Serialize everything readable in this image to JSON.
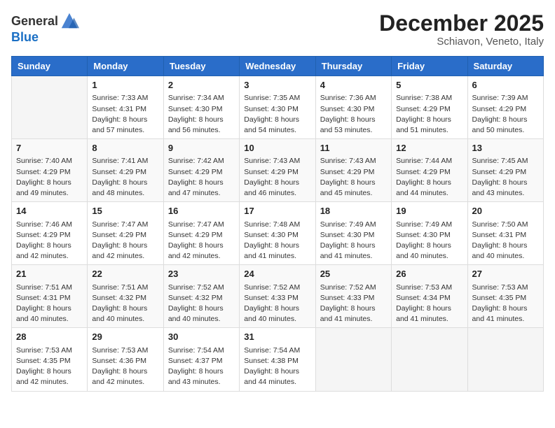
{
  "logo": {
    "general": "General",
    "blue": "Blue"
  },
  "header": {
    "month_year": "December 2025",
    "location": "Schiavon, Veneto, Italy"
  },
  "weekdays": [
    "Sunday",
    "Monday",
    "Tuesday",
    "Wednesday",
    "Thursday",
    "Friday",
    "Saturday"
  ],
  "weeks": [
    [
      {
        "day": "",
        "info": ""
      },
      {
        "day": "1",
        "info": "Sunrise: 7:33 AM\nSunset: 4:31 PM\nDaylight: 8 hours\nand 57 minutes."
      },
      {
        "day": "2",
        "info": "Sunrise: 7:34 AM\nSunset: 4:30 PM\nDaylight: 8 hours\nand 56 minutes."
      },
      {
        "day": "3",
        "info": "Sunrise: 7:35 AM\nSunset: 4:30 PM\nDaylight: 8 hours\nand 54 minutes."
      },
      {
        "day": "4",
        "info": "Sunrise: 7:36 AM\nSunset: 4:30 PM\nDaylight: 8 hours\nand 53 minutes."
      },
      {
        "day": "5",
        "info": "Sunrise: 7:38 AM\nSunset: 4:29 PM\nDaylight: 8 hours\nand 51 minutes."
      },
      {
        "day": "6",
        "info": "Sunrise: 7:39 AM\nSunset: 4:29 PM\nDaylight: 8 hours\nand 50 minutes."
      }
    ],
    [
      {
        "day": "7",
        "info": "Sunrise: 7:40 AM\nSunset: 4:29 PM\nDaylight: 8 hours\nand 49 minutes."
      },
      {
        "day": "8",
        "info": "Sunrise: 7:41 AM\nSunset: 4:29 PM\nDaylight: 8 hours\nand 48 minutes."
      },
      {
        "day": "9",
        "info": "Sunrise: 7:42 AM\nSunset: 4:29 PM\nDaylight: 8 hours\nand 47 minutes."
      },
      {
        "day": "10",
        "info": "Sunrise: 7:43 AM\nSunset: 4:29 PM\nDaylight: 8 hours\nand 46 minutes."
      },
      {
        "day": "11",
        "info": "Sunrise: 7:43 AM\nSunset: 4:29 PM\nDaylight: 8 hours\nand 45 minutes."
      },
      {
        "day": "12",
        "info": "Sunrise: 7:44 AM\nSunset: 4:29 PM\nDaylight: 8 hours\nand 44 minutes."
      },
      {
        "day": "13",
        "info": "Sunrise: 7:45 AM\nSunset: 4:29 PM\nDaylight: 8 hours\nand 43 minutes."
      }
    ],
    [
      {
        "day": "14",
        "info": "Sunrise: 7:46 AM\nSunset: 4:29 PM\nDaylight: 8 hours\nand 42 minutes."
      },
      {
        "day": "15",
        "info": "Sunrise: 7:47 AM\nSunset: 4:29 PM\nDaylight: 8 hours\nand 42 minutes."
      },
      {
        "day": "16",
        "info": "Sunrise: 7:47 AM\nSunset: 4:29 PM\nDaylight: 8 hours\nand 42 minutes."
      },
      {
        "day": "17",
        "info": "Sunrise: 7:48 AM\nSunset: 4:30 PM\nDaylight: 8 hours\nand 41 minutes."
      },
      {
        "day": "18",
        "info": "Sunrise: 7:49 AM\nSunset: 4:30 PM\nDaylight: 8 hours\nand 41 minutes."
      },
      {
        "day": "19",
        "info": "Sunrise: 7:49 AM\nSunset: 4:30 PM\nDaylight: 8 hours\nand 40 minutes."
      },
      {
        "day": "20",
        "info": "Sunrise: 7:50 AM\nSunset: 4:31 PM\nDaylight: 8 hours\nand 40 minutes."
      }
    ],
    [
      {
        "day": "21",
        "info": "Sunrise: 7:51 AM\nSunset: 4:31 PM\nDaylight: 8 hours\nand 40 minutes."
      },
      {
        "day": "22",
        "info": "Sunrise: 7:51 AM\nSunset: 4:32 PM\nDaylight: 8 hours\nand 40 minutes."
      },
      {
        "day": "23",
        "info": "Sunrise: 7:52 AM\nSunset: 4:32 PM\nDaylight: 8 hours\nand 40 minutes."
      },
      {
        "day": "24",
        "info": "Sunrise: 7:52 AM\nSunset: 4:33 PM\nDaylight: 8 hours\nand 40 minutes."
      },
      {
        "day": "25",
        "info": "Sunrise: 7:52 AM\nSunset: 4:33 PM\nDaylight: 8 hours\nand 41 minutes."
      },
      {
        "day": "26",
        "info": "Sunrise: 7:53 AM\nSunset: 4:34 PM\nDaylight: 8 hours\nand 41 minutes."
      },
      {
        "day": "27",
        "info": "Sunrise: 7:53 AM\nSunset: 4:35 PM\nDaylight: 8 hours\nand 41 minutes."
      }
    ],
    [
      {
        "day": "28",
        "info": "Sunrise: 7:53 AM\nSunset: 4:35 PM\nDaylight: 8 hours\nand 42 minutes."
      },
      {
        "day": "29",
        "info": "Sunrise: 7:53 AM\nSunset: 4:36 PM\nDaylight: 8 hours\nand 42 minutes."
      },
      {
        "day": "30",
        "info": "Sunrise: 7:54 AM\nSunset: 4:37 PM\nDaylight: 8 hours\nand 43 minutes."
      },
      {
        "day": "31",
        "info": "Sunrise: 7:54 AM\nSunset: 4:38 PM\nDaylight: 8 hours\nand 44 minutes."
      },
      {
        "day": "",
        "info": ""
      },
      {
        "day": "",
        "info": ""
      },
      {
        "day": "",
        "info": ""
      }
    ]
  ]
}
